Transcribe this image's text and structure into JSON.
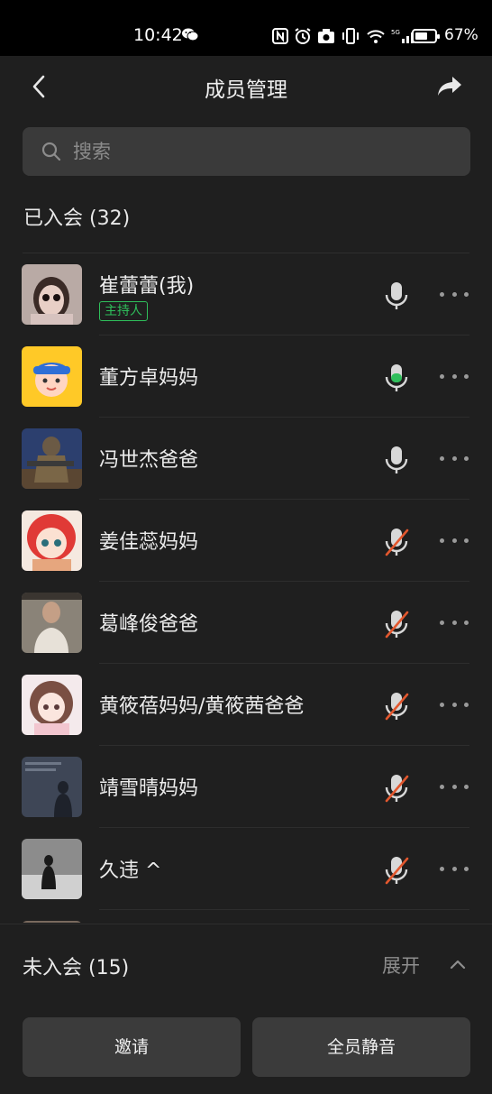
{
  "status_bar": {
    "time": "10:42",
    "battery": "67%",
    "battery_level": 0.67
  },
  "header": {
    "title": "成员管理"
  },
  "search": {
    "placeholder": "搜索"
  },
  "joined": {
    "title": "已入会 (32)"
  },
  "members": [
    {
      "name": "崔蕾蕾(我)",
      "role": "主持人",
      "mic": "on",
      "avatar": "doll-avatar"
    },
    {
      "name": "董方卓妈妈",
      "mic": "speaking",
      "avatar": "cartoon-boy-avatar"
    },
    {
      "name": "冯世杰爸爸",
      "mic": "on",
      "avatar": "soldier-avatar"
    },
    {
      "name": "姜佳蕊妈妈",
      "mic": "muted",
      "avatar": "red-hair-girl-avatar"
    },
    {
      "name": "葛峰俊爸爸",
      "mic": "muted",
      "avatar": "man-photo-avatar"
    },
    {
      "name": "黄筱蓓妈妈/黄筱茜爸爸",
      "mic": "muted",
      "avatar": "anime-girl-avatar"
    },
    {
      "name": "靖雪晴妈妈",
      "mic": "muted",
      "avatar": "night-figure-avatar"
    },
    {
      "name": "久违 ^",
      "mic": "muted",
      "avatar": "snow-walk-avatar"
    }
  ],
  "not_joined": {
    "title": "未入会 (15)",
    "expand_label": "展开"
  },
  "footer": {
    "invite_label": "邀请",
    "mute_all_label": "全员静音"
  },
  "colors": {
    "accent_green": "#2fbf5b",
    "muted_red": "#e2572e",
    "background": "#1f1f1f"
  }
}
